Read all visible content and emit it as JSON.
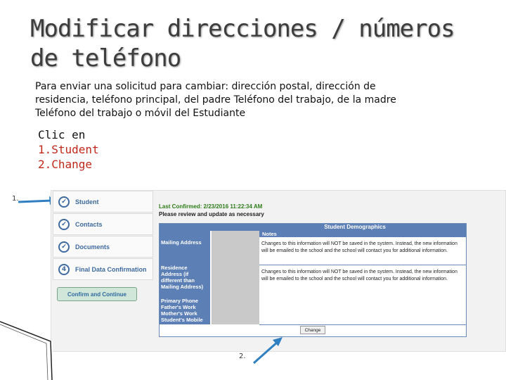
{
  "slide": {
    "title": "Modificar direcciones / números de teléfono",
    "description": "Para enviar una solicitud para cambiar: dirección postal, dirección de residencia, teléfono principal, del padre Teléfono del trabajo, de la madre Teléfono del trabajo o móvil del Estudiante",
    "clic": "Clic en",
    "steps": [
      "1.Student",
      "2.Change"
    ],
    "marker1": "1.",
    "marker2": "2."
  },
  "app": {
    "nav": [
      {
        "label": "Student",
        "status": "✔"
      },
      {
        "label": "Contacts",
        "status": "✔"
      },
      {
        "label": "Documents",
        "status": "✔"
      },
      {
        "label": "Final Data Confirmation",
        "status": "4"
      }
    ],
    "confirm_button": "Confirm and Continue",
    "last_confirmed": "Last Confirmed: 2/23/2016 11:22:34 AM",
    "review_text": "Please review and update as necessary",
    "demographics_header": "Student Demographics",
    "notes_header": "Notes",
    "fields": [
      "Mailing Address",
      "Residence Address (if different than Mailing Address)",
      "Primary Phone",
      "Father's Work",
      "Mother's Work",
      "Student's Mobile"
    ],
    "note_text": "Changes to this information will NOT be saved in the system. Instead, the new information will be emailed to the school and the school will contact you for additional information.",
    "change_button": "Change"
  },
  "colors": {
    "step_red": "#c0281a",
    "nav_blue": "#3f6aa0",
    "header_blue": "#5c7fb5",
    "confirm_green": "#2e7d1a",
    "arrow_blue": "#2f7fc1"
  }
}
